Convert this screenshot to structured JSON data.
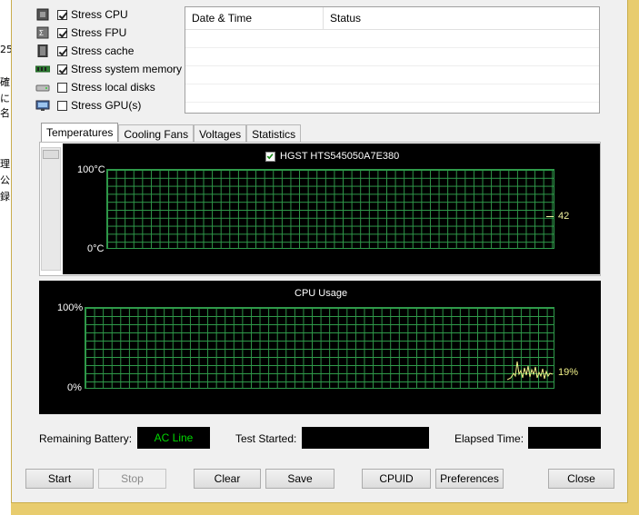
{
  "left_strip_chars": [
    "25",
    "確",
    "に名",
    "理",
    "公",
    "録"
  ],
  "stress_options": [
    {
      "label": "Stress CPU",
      "checked": true,
      "icon": "cpu-icon"
    },
    {
      "label": "Stress FPU",
      "checked": true,
      "icon": "fpu-icon"
    },
    {
      "label": "Stress cache",
      "checked": true,
      "icon": "cache-icon"
    },
    {
      "label": "Stress system memory",
      "checked": true,
      "icon": "memory-icon"
    },
    {
      "label": "Stress local disks",
      "checked": false,
      "icon": "disk-icon"
    },
    {
      "label": "Stress GPU(s)",
      "checked": false,
      "icon": "gpu-icon"
    }
  ],
  "log_table": {
    "columns": [
      "Date & Time",
      "Status"
    ],
    "rows": []
  },
  "tabs": [
    "Temperatures",
    "Cooling Fans",
    "Voltages",
    "Statistics"
  ],
  "active_tab": "Temperatures",
  "temperature_chart": {
    "sensor_label": "HGST HTS545050A7E380",
    "sensor_checked": true,
    "y_max_label": "100°C",
    "y_min_label": "0°C",
    "current_value": "42",
    "series_color": "#f2f2a0"
  },
  "cpu_chart": {
    "title": "CPU Usage",
    "y_max_label": "100%",
    "y_min_label": "0%",
    "current_value": "19%",
    "series_color": "#f2f28a"
  },
  "status": {
    "battery_label": "Remaining Battery:",
    "battery_value": "AC Line",
    "started_label": "Test Started:",
    "started_value": "",
    "elapsed_label": "Elapsed Time:",
    "elapsed_value": ""
  },
  "buttons": {
    "start": "Start",
    "stop": "Stop",
    "clear": "Clear",
    "save": "Save",
    "cpuid": "CPUID",
    "preferences": "Preferences",
    "close": "Close"
  },
  "colors": {
    "grid": "#2f9a4a",
    "accent_green": "#00d800",
    "desktop": "#e8cc6e"
  }
}
